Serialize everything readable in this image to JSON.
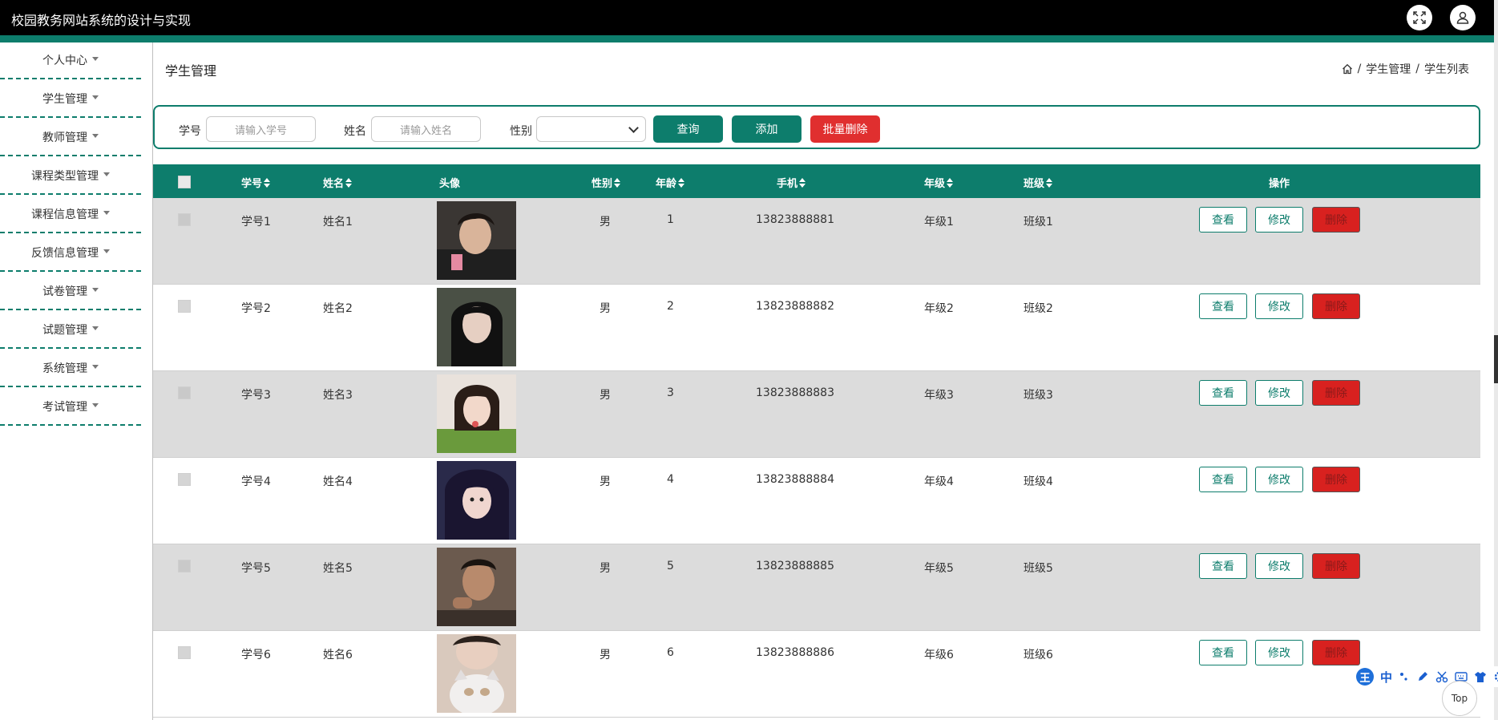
{
  "header": {
    "title": "校园教务网站系统的设计与实现"
  },
  "sidebar": {
    "items": [
      {
        "label": "个人中心"
      },
      {
        "label": "学生管理"
      },
      {
        "label": "教师管理"
      },
      {
        "label": "课程类型管理"
      },
      {
        "label": "课程信息管理"
      },
      {
        "label": "反馈信息管理"
      },
      {
        "label": "试卷管理"
      },
      {
        "label": "试题管理"
      },
      {
        "label": "系统管理"
      },
      {
        "label": "考试管理"
      }
    ]
  },
  "page": {
    "title": "学生管理",
    "breadcrumb": [
      "学生管理",
      "学生列表"
    ],
    "breadcrumb_sep": "/"
  },
  "search": {
    "student_no_label": "学号",
    "student_no_placeholder": "请输入学号",
    "name_label": "姓名",
    "name_placeholder": "请输入姓名",
    "gender_label": "性别",
    "gender_value": "",
    "query_label": "查询",
    "add_label": "添加",
    "batch_delete_label": "批量删除"
  },
  "table": {
    "columns": [
      "学号",
      "姓名",
      "头像",
      "性别",
      "年龄",
      "手机",
      "年级",
      "班级",
      "操作"
    ],
    "actions": {
      "view": "查看",
      "edit": "修改",
      "delete": "删除"
    },
    "rows": [
      {
        "student_no": "学号1",
        "name": "姓名1",
        "gender": "男",
        "age": "1",
        "phone": "13823888881",
        "grade": "年级1",
        "class": "班级1"
      },
      {
        "student_no": "学号2",
        "name": "姓名2",
        "gender": "男",
        "age": "2",
        "phone": "13823888882",
        "grade": "年级2",
        "class": "班级2"
      },
      {
        "student_no": "学号3",
        "name": "姓名3",
        "gender": "男",
        "age": "3",
        "phone": "13823888883",
        "grade": "年级3",
        "class": "班级3"
      },
      {
        "student_no": "学号4",
        "name": "姓名4",
        "gender": "男",
        "age": "4",
        "phone": "13823888884",
        "grade": "年级4",
        "class": "班级4"
      },
      {
        "student_no": "学号5",
        "name": "姓名5",
        "gender": "男",
        "age": "5",
        "phone": "13823888885",
        "grade": "年级5",
        "class": "班级5"
      },
      {
        "student_no": "学号6",
        "name": "姓名6",
        "gender": "男",
        "age": "6",
        "phone": "13823888886",
        "grade": "年级6",
        "class": "班级6"
      }
    ]
  },
  "widgets": {
    "top_label": "Top",
    "ime_logo": "王",
    "ime_mode": "中"
  },
  "colors": {
    "accent": "#0d7d6c",
    "danger": "#e02f2f",
    "header_bg": "#000000"
  }
}
